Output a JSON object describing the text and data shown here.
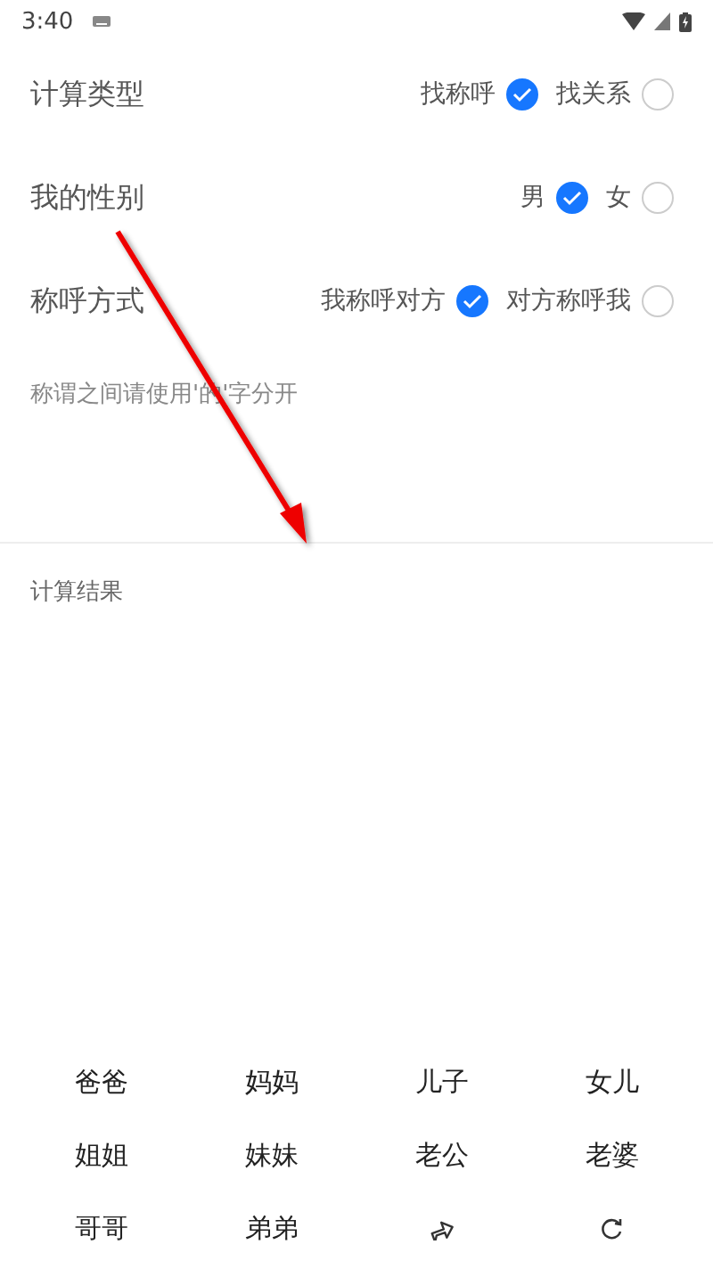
{
  "status_bar": {
    "time": "3:40"
  },
  "options": [
    {
      "label": "计算类型",
      "choices": [
        {
          "label": "找称呼",
          "selected": true
        },
        {
          "label": "找关系",
          "selected": false
        }
      ]
    },
    {
      "label": "我的性别",
      "choices": [
        {
          "label": "男",
          "selected": true
        },
        {
          "label": "女",
          "selected": false
        }
      ]
    },
    {
      "label": "称呼方式",
      "choices": [
        {
          "label": "我称呼对方",
          "selected": true
        },
        {
          "label": "对方称呼我",
          "selected": false
        }
      ]
    }
  ],
  "input": {
    "placeholder": "称谓之间请使用'的'字分开"
  },
  "result": {
    "label": "计算结果"
  },
  "keypad": [
    {
      "kind": "text",
      "label": "爸爸"
    },
    {
      "kind": "text",
      "label": "妈妈"
    },
    {
      "kind": "text",
      "label": "儿子"
    },
    {
      "kind": "text",
      "label": "女儿"
    },
    {
      "kind": "text",
      "label": "姐姐"
    },
    {
      "kind": "text",
      "label": "妹妹"
    },
    {
      "kind": "text",
      "label": "老公"
    },
    {
      "kind": "text",
      "label": "老婆"
    },
    {
      "kind": "text",
      "label": "哥哥"
    },
    {
      "kind": "text",
      "label": "弟弟"
    },
    {
      "kind": "forward"
    },
    {
      "kind": "reset"
    }
  ]
}
